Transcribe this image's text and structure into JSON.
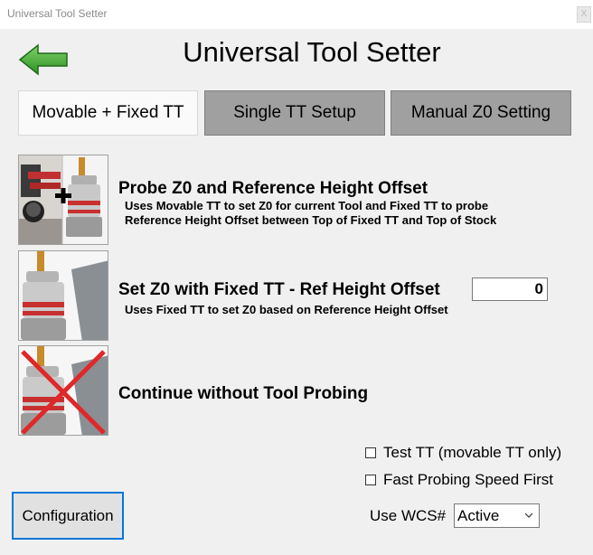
{
  "window": {
    "title": "Universal Tool Setter",
    "close_glyph": "X"
  },
  "header": {
    "title": "Universal Tool Setter",
    "back_icon": "green-left-arrow-icon"
  },
  "tabs": [
    {
      "label": "Movable + Fixed TT",
      "active": true
    },
    {
      "label": "Single TT Setup",
      "active": false
    },
    {
      "label": "Manual Z0 Setting",
      "active": false
    }
  ],
  "options": [
    {
      "title": "Probe Z0 and Reference Height Offset",
      "desc_lines": [
        "Uses Movable TT to set Z0 for current Tool and Fixed TT to probe",
        "Reference Height Offset between Top of Fixed TT and Top of Stock"
      ]
    },
    {
      "title": "Set Z0 with Fixed TT - Ref Height Offset",
      "desc_lines": [
        "Uses Fixed TT to set Z0 based on Reference Height Offset"
      ],
      "offset_value": "0"
    },
    {
      "title": "Continue without Tool Probing"
    }
  ],
  "checkboxes": [
    {
      "label": "Test TT (movable TT only)",
      "checked": false
    },
    {
      "label": "Fast Probing Speed First",
      "checked": false
    }
  ],
  "footer": {
    "config_label": "Configuration",
    "wcs_label": "Use WCS#",
    "wcs_value": "Active"
  },
  "colors": {
    "accent": "#0078d7",
    "arrow": "#3a9a2a",
    "inactive_tab": "#a0a0a0",
    "cross": "#e02828"
  }
}
